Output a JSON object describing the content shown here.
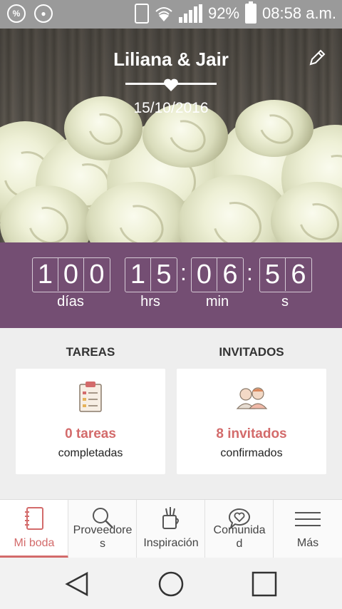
{
  "status_bar": {
    "battery_percent": "92%",
    "time": "08:58 a.m.",
    "icons": [
      "percent-icon",
      "notification-icon",
      "phone-vibrate-icon",
      "wifi-icon",
      "signal-icon",
      "battery-icon"
    ]
  },
  "header": {
    "couple_names": "Liliana & Jair",
    "wedding_date": "15/10/2016",
    "edit_icon": "pencil-icon"
  },
  "countdown": {
    "days": [
      "1",
      "0",
      "0"
    ],
    "hours": [
      "1",
      "5"
    ],
    "minutes": [
      "0",
      "6"
    ],
    "seconds": [
      "5",
      "6"
    ],
    "labels": {
      "days": "días",
      "hours": "hrs",
      "minutes": "min",
      "seconds": "s"
    },
    "separator": ":"
  },
  "summary": {
    "tasks": {
      "title": "TAREAS",
      "count": "0 tareas",
      "subtitle": "completadas",
      "icon": "clipboard-icon"
    },
    "guests": {
      "title": "INVITADOS",
      "count": "8 invitados",
      "subtitle": "confirmados",
      "icon": "guests-icon"
    }
  },
  "tabs": [
    {
      "label": "Mi boda",
      "icon": "notebook-icon",
      "active": true
    },
    {
      "label": "Proveedore\ns",
      "icon": "search-icon",
      "active": false
    },
    {
      "label": "Inspiración",
      "icon": "inspiration-cup-icon",
      "active": false
    },
    {
      "label": "Comunida\nd",
      "icon": "heart-chat-icon",
      "active": false
    },
    {
      "label": "Más",
      "icon": "menu-icon",
      "active": false
    }
  ],
  "colors": {
    "accent": "#d36b6b",
    "countdown_bg": "#744e73",
    "status_bar_bg": "#9a9a9a",
    "summary_bg": "#eeeeee"
  }
}
